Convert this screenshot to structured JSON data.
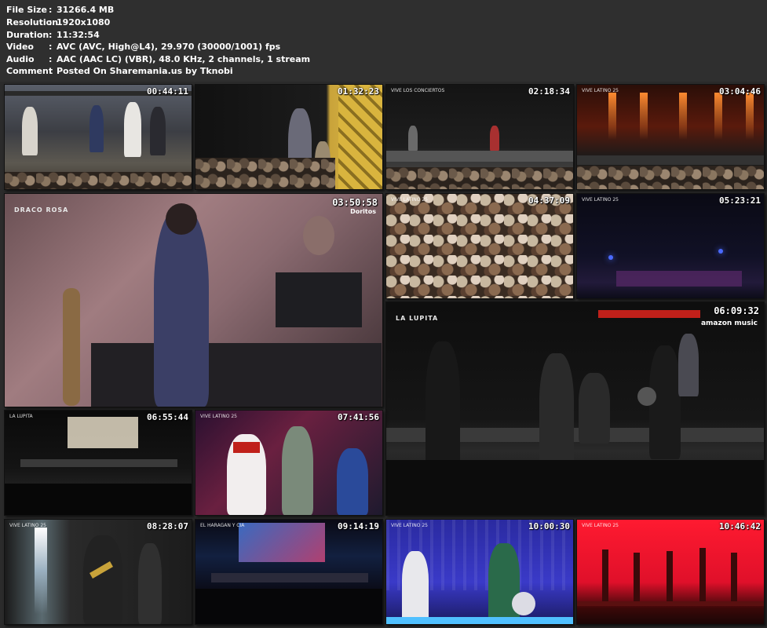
{
  "info": {
    "rows": [
      {
        "key": "File Size",
        "value": "31266.4 MB"
      },
      {
        "key": "Resolution",
        "value": "1920x1080"
      },
      {
        "key": "Duration",
        "value": "11:32:54"
      },
      {
        "key": "Video",
        "value": "AVC (AVC, High@L4), 29.970 (30000/1001) fps"
      },
      {
        "key": "Audio",
        "value": "AAC (AAC LC) (VBR), 48.0 KHz, 2 channels, 1 stream"
      },
      {
        "key": "Comment",
        "value": "Posted On Sharemania.us by Tknobi"
      }
    ],
    "separator": ":"
  },
  "thumbs": {
    "t1": {
      "time": "00:44:11"
    },
    "t2": {
      "time": "01:32:23"
    },
    "t3": {
      "time": "02:18:34",
      "logo": "VIVE LOS CONCIERTOS"
    },
    "t4": {
      "time": "03:04:46",
      "logo": "VIVE LATINO 25"
    },
    "t5": {
      "time": "03:50:58",
      "artist": "DRACO ROSA",
      "sponsor": "Doritos"
    },
    "t6": {
      "time": "04:37:09",
      "logo": "VIVE LATINO 25"
    },
    "t7": {
      "time": "05:23:21",
      "logo": "VIVE LATINO 25"
    },
    "t8": {
      "time": "06:09:32",
      "artist": "LA LUPITA",
      "brand": "amazon music"
    },
    "t9": {
      "time": "06:55:44",
      "logo": "LA LUPITA"
    },
    "t10": {
      "time": "07:41:56",
      "logo": "VIVE LATINO 25"
    },
    "t11": {
      "time": "08:28:07",
      "logo": "VIVE LATINO 25"
    },
    "t12": {
      "time": "09:14:19",
      "logo": "EL HARAGAN Y CIA"
    },
    "t13": {
      "time": "10:00:30",
      "logo": "VIVE LATINO 25"
    },
    "t14": {
      "time": "10:46:42",
      "logo": "VIVE LATINO 25"
    }
  },
  "colors": {
    "background": "#2b2b2b",
    "text": "#ffffff"
  }
}
